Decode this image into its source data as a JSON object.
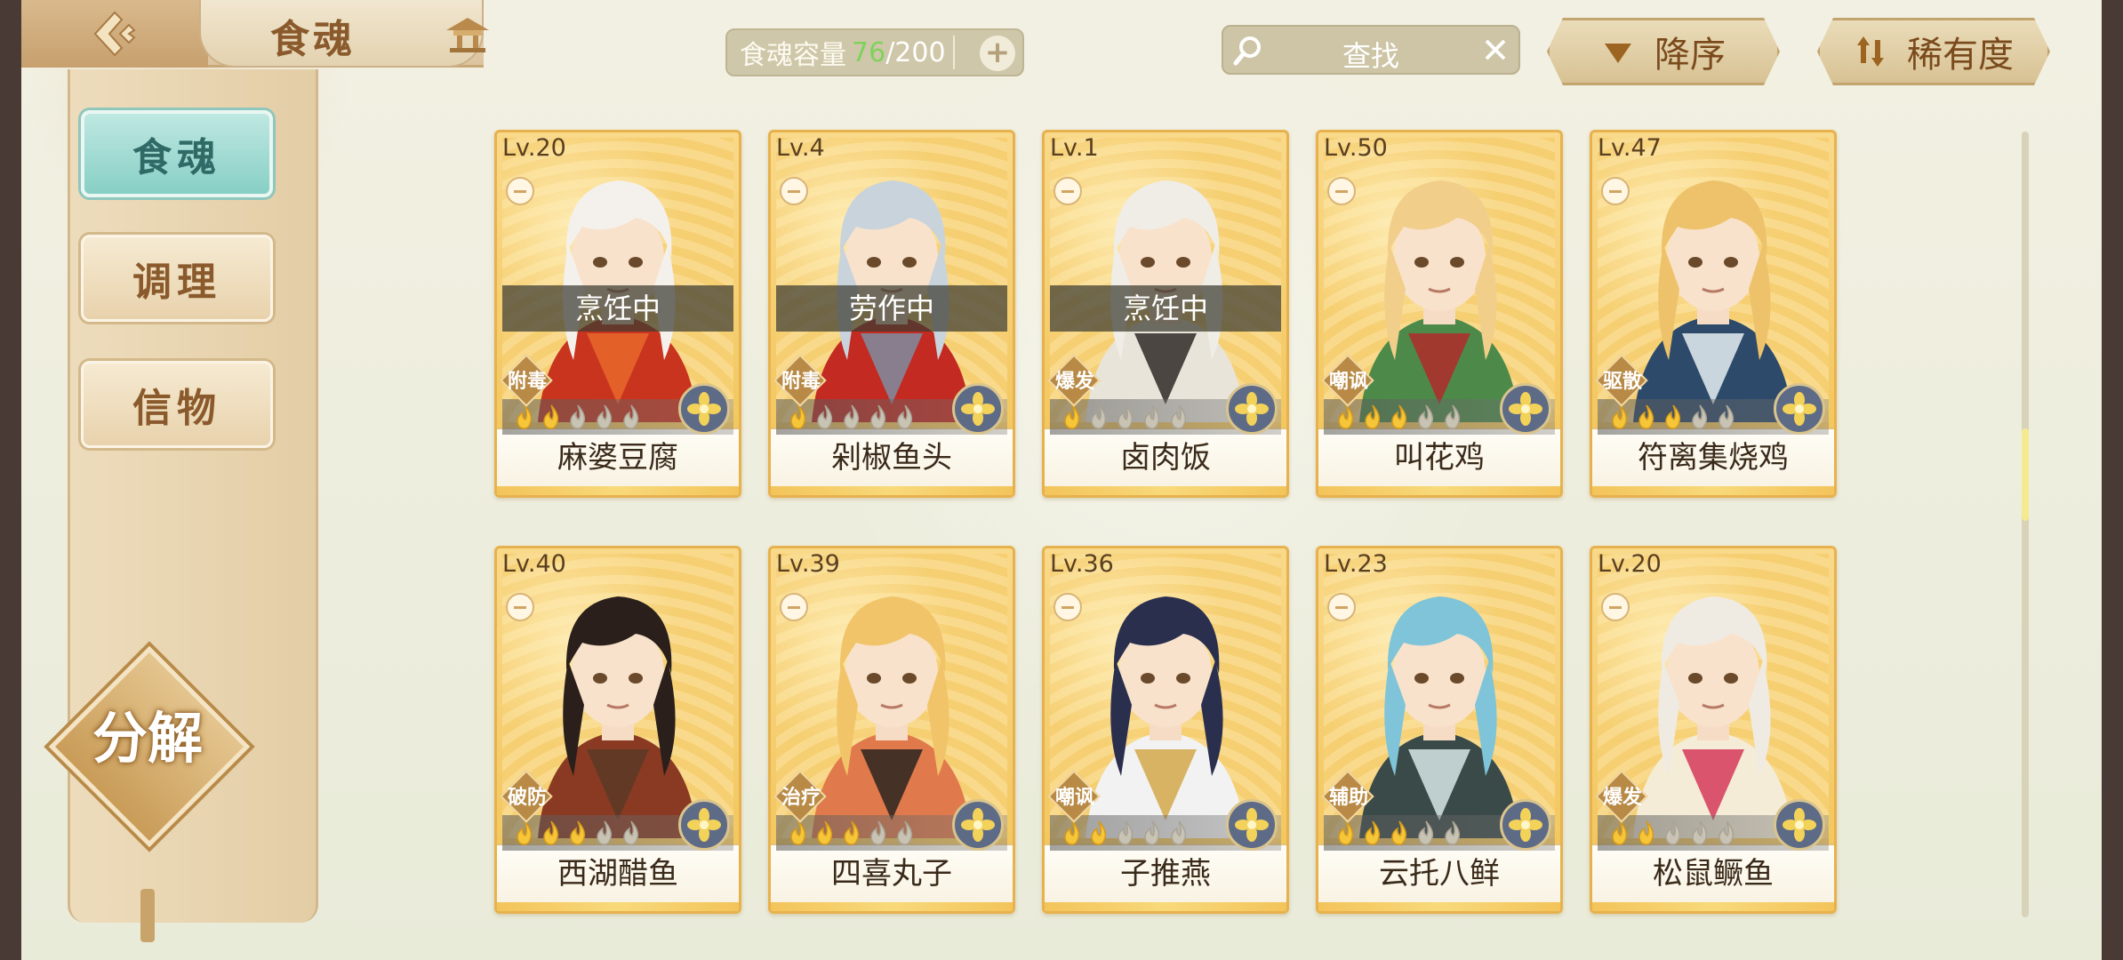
{
  "header": {
    "title": "食魂",
    "capacity_label": "食魂容量",
    "capacity_current": "76",
    "capacity_sep": "/",
    "capacity_max": "200",
    "add_symbol": "+",
    "search_placeholder": "查找",
    "sort_order_label": "降序",
    "sort_key_label": "稀有度"
  },
  "sidebar": {
    "tabs": [
      {
        "label": "食魂",
        "active": true
      },
      {
        "label": "调理",
        "active": false
      },
      {
        "label": "信物",
        "active": false
      }
    ],
    "decompose_label": "分解"
  },
  "cards": [
    {
      "level": "Lv.20",
      "status": "烹饪中",
      "role": "附毒",
      "stars": 2,
      "name": "麻婆豆腐",
      "hair": "#f4f1ec",
      "outfit": "#c8341e",
      "accent": "#e9692c"
    },
    {
      "level": "Lv.4",
      "status": "劳作中",
      "role": "附毒",
      "stars": 1,
      "name": "剁椒鱼头",
      "hair": "#c9d3dc",
      "outfit": "#c22a22",
      "accent": "#7f8da0"
    },
    {
      "level": "Lv.1",
      "status": "烹饪中",
      "role": "爆发",
      "stars": 1,
      "name": "卤肉饭",
      "hair": "#f0ede6",
      "outfit": "#e8e4da",
      "accent": "#2f2a26"
    },
    {
      "level": "Lv.50",
      "status": "",
      "role": "嘲讽",
      "stars": 3,
      "name": "叫花鸡",
      "hair": "#f1cf8a",
      "outfit": "#4d8a4a",
      "accent": "#b02a2a"
    },
    {
      "level": "Lv.47",
      "status": "",
      "role": "驱散",
      "stars": 3,
      "name": "符离集烧鸡",
      "hair": "#edc26b",
      "outfit": "#2d4a6a",
      "accent": "#e6eef2"
    },
    {
      "level": "Lv.40",
      "status": "",
      "role": "破防",
      "stars": 3,
      "name": "西湖醋鱼",
      "hair": "#2a1f1a",
      "outfit": "#8a3a22",
      "accent": "#5a3a26"
    },
    {
      "level": "Lv.39",
      "status": "",
      "role": "治疗",
      "stars": 3,
      "name": "四喜丸子",
      "hair": "#f1c46a",
      "outfit": "#e07a4c",
      "accent": "#2a2420"
    },
    {
      "level": "Lv.36",
      "status": "",
      "role": "嘲讽",
      "stars": 2,
      "name": "子推燕",
      "hair": "#2b2f4e",
      "outfit": "#f2f2f2",
      "accent": "#d4a84a"
    },
    {
      "level": "Lv.23",
      "status": "",
      "role": "辅助",
      "stars": 3,
      "name": "云托八鲜",
      "hair": "#7fc4d8",
      "outfit": "#3a4a48",
      "accent": "#d7e6e8"
    },
    {
      "level": "Lv.20",
      "status": "",
      "role": "爆发",
      "stars": 2,
      "name": "松鼠鳜鱼",
      "hair": "#f0ebe2",
      "outfit": "#f4ecd6",
      "accent": "#d63a5a"
    }
  ],
  "colors": {
    "accent_teal": "#87cfc5",
    "capacity_current": "#7fd25d",
    "card_gold": "#f2c356"
  },
  "icons": {
    "back": "back-arrow-icon",
    "home": "pavilion-icon",
    "search": "magnifier-icon",
    "clear": "close-icon",
    "sort_order": "triangle-down-icon",
    "sort_key": "sort-toggle-icon",
    "element": "flower-icon",
    "star": "flame-icon"
  }
}
